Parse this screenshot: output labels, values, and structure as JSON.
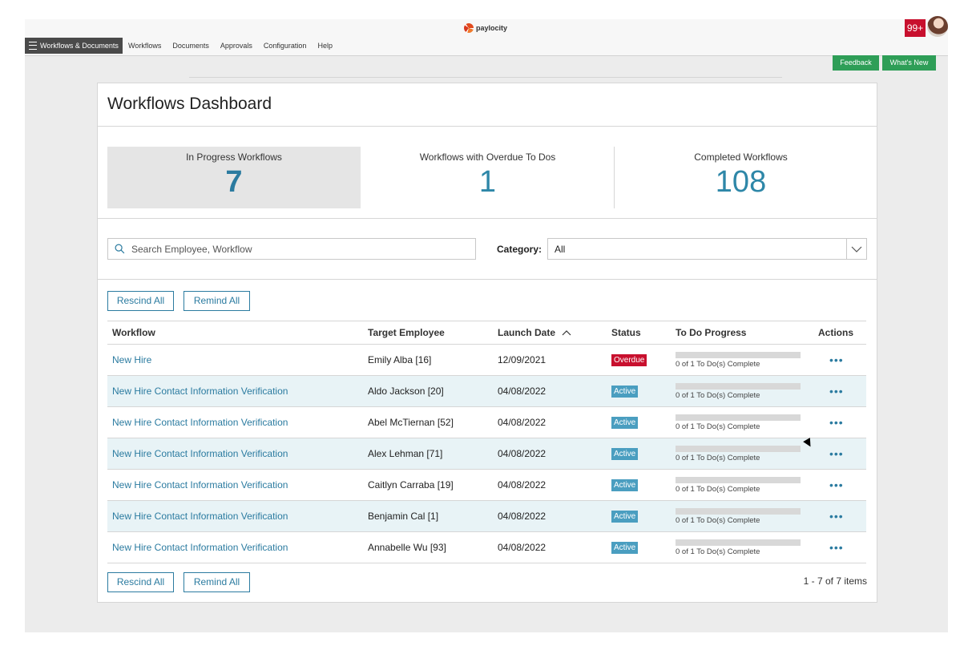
{
  "app": {
    "brand": "paylocity",
    "notification_count": "99+"
  },
  "nav": {
    "menu_label": "Workflows & Documents",
    "links": [
      "Workflows",
      "Documents",
      "Approvals",
      "Configuration",
      "Help"
    ]
  },
  "top_actions": {
    "feedback": "Feedback",
    "whats_new": "What's New"
  },
  "dashboard": {
    "title": "Workflows Dashboard",
    "stats": [
      {
        "label": "In Progress Workflows",
        "value": "7"
      },
      {
        "label": "Workflows with Overdue To Dos",
        "value": "1"
      },
      {
        "label": "Completed Workflows",
        "value": "108"
      }
    ]
  },
  "filters": {
    "search_placeholder": "Search Employee, Workflow",
    "category_label": "Category:",
    "category_value": "All"
  },
  "buttons": {
    "rescind_all": "Rescind All",
    "remind_all": "Remind All"
  },
  "table": {
    "headers": [
      "Workflow",
      "Target Employee",
      "Launch Date",
      "Status",
      "To Do Progress",
      "Actions"
    ],
    "rows": [
      {
        "workflow": "New Hire",
        "employee": "Emily Alba [16]",
        "date": "12/09/2021",
        "status": "Overdue",
        "progress_text": "0 of 1 To Do(s) Complete",
        "progress_fraction": 0,
        "actions": "•••"
      },
      {
        "workflow": "New Hire Contact Information Verification",
        "employee": "Aldo Jackson [20]",
        "date": "04/08/2022",
        "status": "Active",
        "progress_text": "0 of 1 To Do(s) Complete",
        "progress_fraction": 0,
        "actions": "•••"
      },
      {
        "workflow": "New Hire Contact Information Verification",
        "employee": "Abel McTiernan [52]",
        "date": "04/08/2022",
        "status": "Active",
        "progress_text": "0 of 1 To Do(s) Complete",
        "progress_fraction": 0,
        "actions": "•••"
      },
      {
        "workflow": "New Hire Contact Information Verification",
        "employee": "Alex Lehman [71]",
        "date": "04/08/2022",
        "status": "Active",
        "progress_text": "0 of 1 To Do(s) Complete",
        "progress_fraction": 0,
        "actions": "•••"
      },
      {
        "workflow": "New Hire Contact Information Verification",
        "employee": "Caitlyn Carraba [19]",
        "date": "04/08/2022",
        "status": "Active",
        "progress_text": "0 of 1 To Do(s) Complete",
        "progress_fraction": 0,
        "actions": "•••"
      },
      {
        "workflow": "New Hire Contact Information Verification",
        "employee": "Benjamin Cal [1]",
        "date": "04/08/2022",
        "status": "Active",
        "progress_text": "0 of 1 To Do(s) Complete",
        "progress_fraction": 0,
        "actions": "•••"
      },
      {
        "workflow": "New Hire Contact Information Verification",
        "employee": "Annabelle Wu [93]",
        "date": "04/08/2022",
        "status": "Active",
        "progress_text": "0 of 1 To Do(s) Complete",
        "progress_fraction": 0,
        "actions": "•••"
      }
    ]
  },
  "pager": {
    "text": "1 - 7 of 7 items"
  },
  "colors": {
    "accent": "#2b7ba0",
    "overdue": "#c8102e",
    "active": "#4a9ec0",
    "green": "#2e9e57",
    "row_alt": "#e8f3f6"
  }
}
